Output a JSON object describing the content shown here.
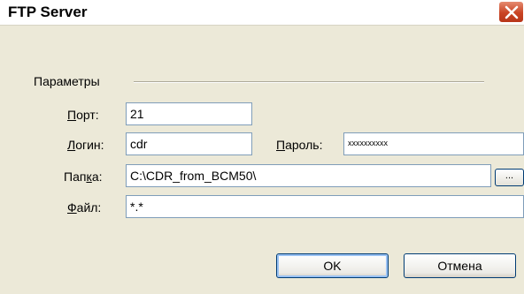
{
  "window": {
    "title": "FTP Server"
  },
  "group": {
    "caption": "Параметры"
  },
  "fields": {
    "port": {
      "label_pre": "",
      "label_mnemonic": "П",
      "label_post": "орт:",
      "value": "21"
    },
    "login": {
      "label_pre": "",
      "label_mnemonic": "Л",
      "label_post": "огин:",
      "value": "cdr"
    },
    "password": {
      "label_pre": "",
      "label_mnemonic": "П",
      "label_post": "ароль:",
      "value": "xxxxxxxxxx"
    },
    "folder": {
      "label_pre": "Пап",
      "label_mnemonic": "к",
      "label_post": "а:",
      "value": "C:\\CDR_from_BCM50\\",
      "browse_label": "..."
    },
    "file": {
      "label_pre": "",
      "label_mnemonic": "Ф",
      "label_post": "айл:",
      "value": "*.*"
    }
  },
  "buttons": {
    "ok_label": "OK",
    "cancel_label": "Отмена"
  },
  "icons": {
    "close": "close-icon"
  },
  "colors": {
    "dialog_bg": "#ece9d8",
    "close_red": "#c94424",
    "input_border": "#7f9db9"
  }
}
